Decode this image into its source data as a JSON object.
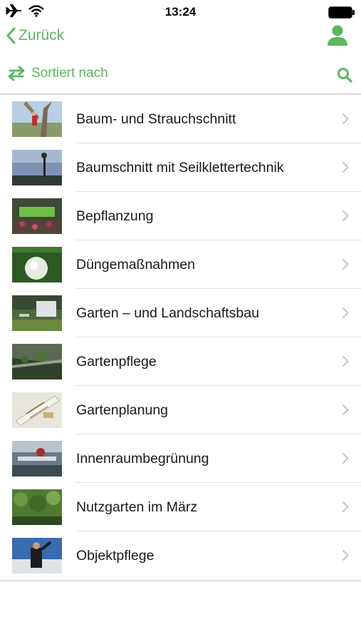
{
  "status": {
    "time": "13:24"
  },
  "nav": {
    "back_label": "Zurück"
  },
  "sort": {
    "label": "Sortiert nach"
  },
  "items": [
    {
      "label": "Baum- und Strauchschnitt"
    },
    {
      "label": "Baumschnitt mit Seilklettertechnik"
    },
    {
      "label": "Bepflanzung"
    },
    {
      "label": "Düngemaßnahmen"
    },
    {
      "label": "Garten – und Landschaftsbau"
    },
    {
      "label": "Gartenpflege"
    },
    {
      "label": "Gartenplanung"
    },
    {
      "label": "Innenraumbegrünung"
    },
    {
      "label": "Nutzgarten im März"
    },
    {
      "label": "Objektpflege"
    }
  ],
  "colors": {
    "accent": "#5bb85b",
    "divider": "#e3e3e3"
  },
  "icons": [
    "airplane-icon",
    "wifi-icon",
    "battery-icon",
    "chevron-left-icon",
    "user-icon",
    "swap-arrows-icon",
    "search-icon",
    "chevron-right-icon"
  ]
}
